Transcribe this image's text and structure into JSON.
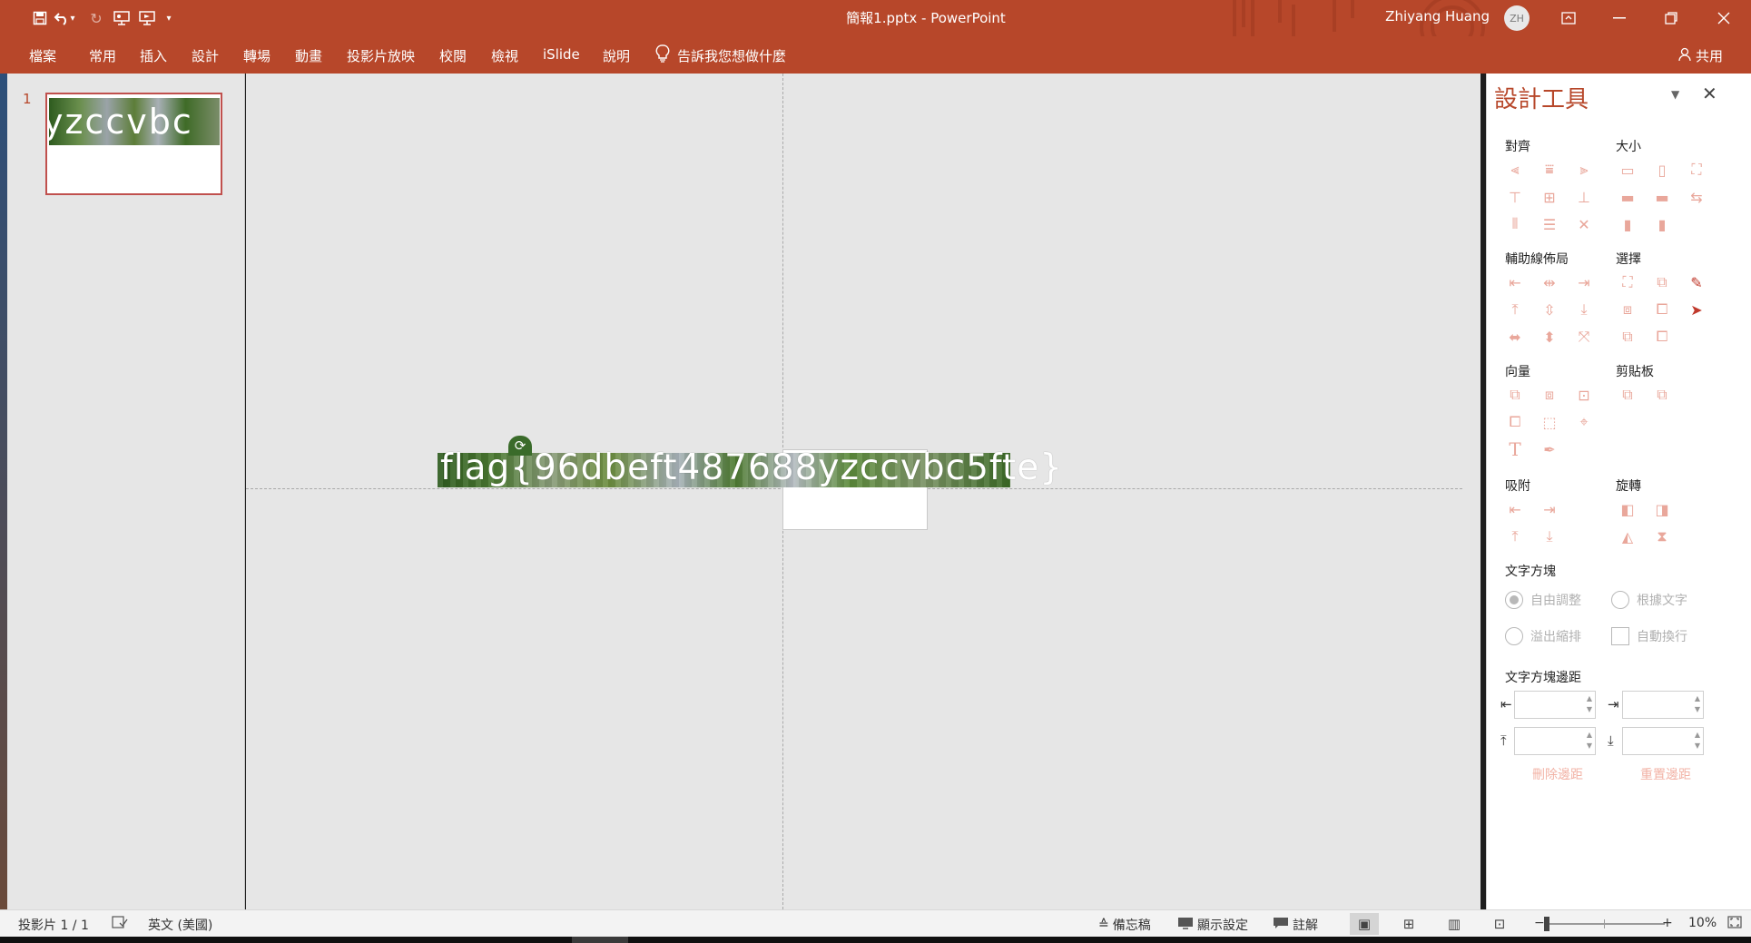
{
  "window": {
    "title": "簡報1.pptx  -  PowerPoint",
    "user_name": "Zhiyang Huang",
    "user_initials": "ZH",
    "brand_color": "#b7472a"
  },
  "quick_access": [
    {
      "name": "save-icon",
      "glyph": "🖫"
    },
    {
      "name": "undo-icon",
      "glyph": "↶"
    },
    {
      "name": "undo-dropdown-icon",
      "glyph": "▾"
    },
    {
      "name": "redo-icon",
      "glyph": "↻"
    },
    {
      "name": "present-from-start-icon",
      "glyph": "▣"
    },
    {
      "name": "present-icon",
      "glyph": "▤"
    },
    {
      "name": "customize-qat-icon",
      "glyph": "▾"
    }
  ],
  "ribbon": {
    "tabs": [
      "檔案",
      "常用",
      "插入",
      "設計",
      "轉場",
      "動畫",
      "投影片放映",
      "校閱",
      "檢視",
      "iSlide",
      "說明"
    ],
    "tell_me": "告訴我您想做什麼",
    "share": "共用"
  },
  "thumbnails": {
    "number": "1",
    "preview_text": "yzccvbc"
  },
  "slide": {
    "flag_text": "flag{96dbeft487688yzccvbc5fte}"
  },
  "design_pane": {
    "title": "設計工具",
    "sections": {
      "align": "對齊",
      "size": "大小",
      "guide_layout": "輔助線佈局",
      "select": "選擇",
      "vector": "向量",
      "clipboard": "剪貼板",
      "snap": "吸附",
      "rotate": "旋轉",
      "text_box": "文字方塊",
      "text_box_margin": "文字方塊邊距"
    },
    "options": {
      "free_adjust": "自由調整",
      "fit_to_text": "根據文字",
      "overflow_shrink": "溢出縮排",
      "auto_wrap": "自動換行"
    },
    "links": {
      "remove_margin": "刪除邊距",
      "reset_margin": "重置邊距"
    }
  },
  "status": {
    "slide_counter": "投影片 1 / 1",
    "language": "英文 (美國)",
    "notes": "備忘稿",
    "display_settings": "顯示設定",
    "comments": "註解",
    "zoom": "10%"
  }
}
